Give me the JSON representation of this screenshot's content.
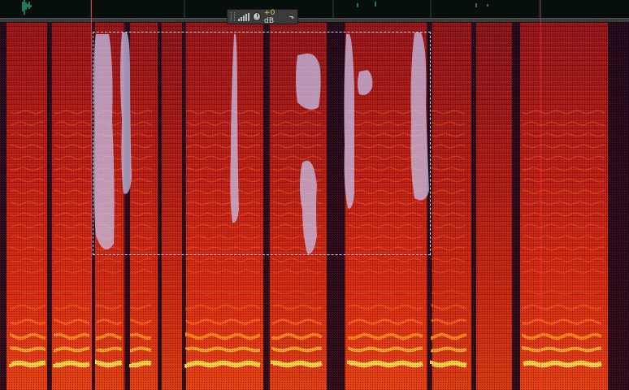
{
  "hud": {
    "gain_sign": "+0",
    "gain_unit": " dB"
  },
  "icons": {
    "grip": "grip-handle-icon",
    "meter": "level-meter-icon",
    "knob": "gain-knob-icon",
    "pin": "pin-icon"
  },
  "colors": {
    "overview_waveform": "#3fe0a8",
    "spectrogram_low": "#12061a",
    "spectrogram_mid": "#b0141a",
    "spectrogram_high": "#ffe566",
    "selection_overlay": "#c8c8f0",
    "playhead": "#ff3550"
  }
}
